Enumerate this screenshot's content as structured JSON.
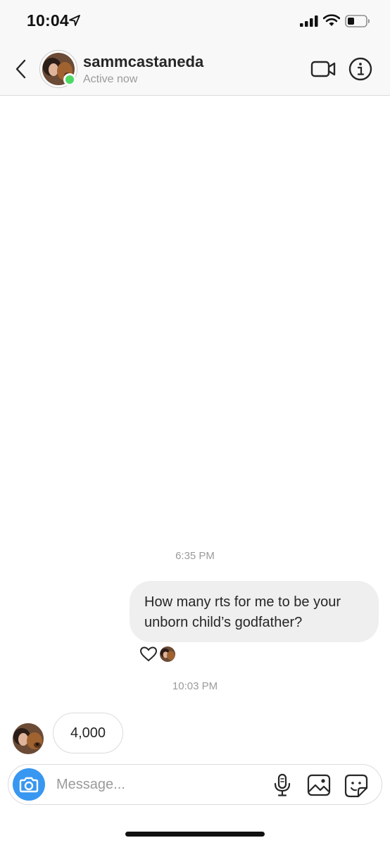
{
  "status_bar": {
    "time": "10:04"
  },
  "header": {
    "username": "sammcastaneda",
    "activity": "Active now"
  },
  "messages": [
    {
      "type": "timestamp",
      "text": "6:35 PM"
    },
    {
      "type": "sent",
      "text": "How many rts for me to be your unborn child’s godfather?",
      "reaction": "heart-icon"
    },
    {
      "type": "timestamp",
      "text": "10:03 PM"
    },
    {
      "type": "received",
      "text": "4,000"
    }
  ],
  "composer": {
    "placeholder": "Message..."
  },
  "colors": {
    "accent": "#3897f0",
    "online": "#4cd964",
    "bubble_sent_bg": "#efefef",
    "header_bg": "#f8f8f8"
  },
  "icons": [
    "location-arrow-icon",
    "signal-icon",
    "wifi-icon",
    "battery-icon",
    "back-chevron-icon",
    "video-call-icon",
    "info-icon",
    "heart-icon",
    "camera-icon",
    "microphone-icon",
    "gallery-icon",
    "sticker-icon"
  ]
}
